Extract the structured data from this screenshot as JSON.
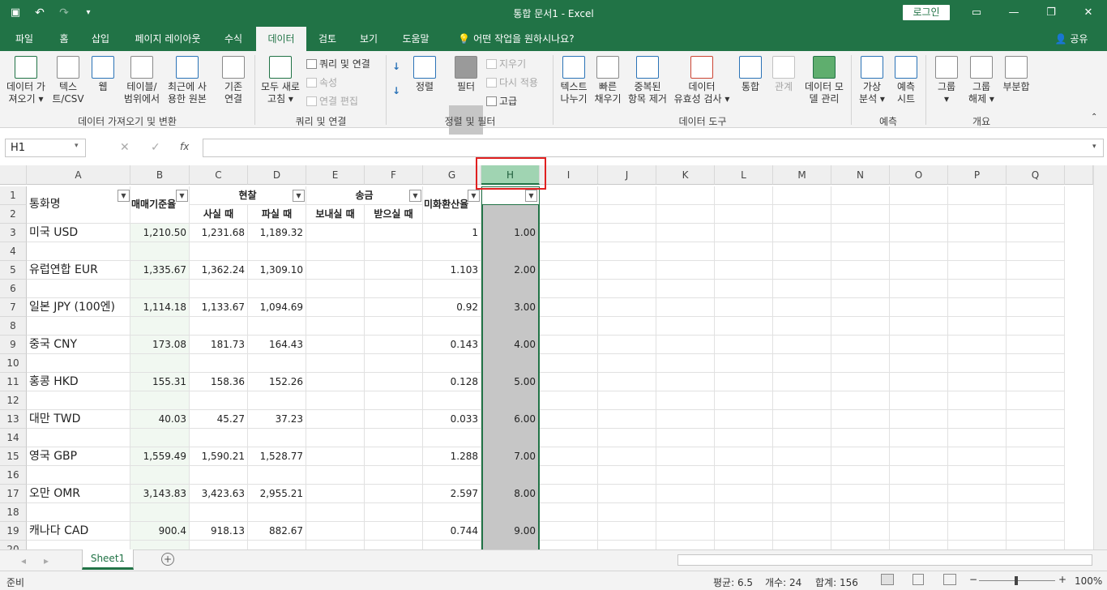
{
  "titlebar": {
    "title": "통합 문서1  -  Excel",
    "login": "로그인",
    "undo_icon": "↶",
    "redo_icon": "↷",
    "save_icon": "save",
    "customize": "▾"
  },
  "tabs": [
    "파일",
    "홈",
    "삽입",
    "페이지 레이아웃",
    "수식",
    "데이터",
    "검토",
    "보기",
    "도움말",
    "💡 어떤 작업을 원하시나요?"
  ],
  "share": "공유",
  "ribbon": {
    "get_data": [
      "데이터 가",
      "져오기 ▾"
    ],
    "text_csv": [
      "텍스",
      "트/CSV"
    ],
    "web": "웹",
    "from_table": [
      "테이블/",
      "범위에서"
    ],
    "recent_source": [
      "최근에 사",
      "용한 원본"
    ],
    "existing_conn": [
      "기존",
      "연결"
    ],
    "group_get": "데이터 가져오기 및 변환",
    "refresh_all": [
      "모두 새로",
      "고침 ▾"
    ],
    "queries_conn": "쿼리 및 연결",
    "properties": "속성",
    "edit_links": "연결 편집",
    "group_queries": "쿼리 및 연결",
    "sort_az": "↓",
    "sort_za": "↓",
    "sort": "정렬",
    "filter": "필터",
    "clear": "지우기",
    "reapply": "다시 적용",
    "advanced": "고급",
    "group_sort": "정렬 및 필터",
    "text_to_col": [
      "텍스트",
      "나누기"
    ],
    "flash_fill": [
      "빠른",
      "채우기"
    ],
    "remove_dup": [
      "중복된",
      "항목 제거"
    ],
    "data_valid": [
      "데이터",
      "유효성 검사 ▾"
    ],
    "consolidate": "통합",
    "relations": "관계",
    "data_model": [
      "데이터 모",
      "델 관리"
    ],
    "group_tools": "데이터 도구",
    "what_if": [
      "가상",
      "분석 ▾"
    ],
    "forecast_sheet": [
      "예측",
      "시트"
    ],
    "group_forecast": "예측",
    "group_btn": [
      "그룹",
      "▾"
    ],
    "ungroup": [
      "그룹",
      "해제 ▾"
    ],
    "subtotal": "부분합",
    "group_outline": "개요"
  },
  "formula_bar": {
    "name_box": "H1",
    "fx": "fx",
    "value": "",
    "cancel": "✕",
    "enter": "✓"
  },
  "columns": [
    "A",
    "B",
    "C",
    "D",
    "E",
    "F",
    "G",
    "H",
    "I",
    "J",
    "K",
    "L",
    "M",
    "N",
    "O",
    "P",
    "Q"
  ],
  "header": {
    "a": "통화명",
    "b": "매매기준율",
    "cash": "현찰",
    "buy": "사실 때",
    "sell": "파실 때",
    "transfer": "송금",
    "send": "보내실 때",
    "receive": "받으실 때",
    "usd_rate": "미화환산율"
  },
  "rows": [
    {
      "r": 3,
      "a": "미국 USD",
      "b": "1,210.50",
      "c": "1,231.68",
      "d": "1,189.32",
      "g": "1",
      "h": "1.00"
    },
    {
      "r": 5,
      "a": "유럽연합 EUR",
      "b": "1,335.67",
      "c": "1,362.24",
      "d": "1,309.10",
      "g": "1.103",
      "h": "2.00"
    },
    {
      "r": 7,
      "a": "일본 JPY (100엔)",
      "b": "1,114.18",
      "c": "1,133.67",
      "d": "1,094.69",
      "g": "0.92",
      "h": "3.00"
    },
    {
      "r": 9,
      "a": "중국 CNY",
      "b": "173.08",
      "c": "181.73",
      "d": "164.43",
      "g": "0.143",
      "h": "4.00"
    },
    {
      "r": 11,
      "a": "홍콩 HKD",
      "b": "155.31",
      "c": "158.36",
      "d": "152.26",
      "g": "0.128",
      "h": "5.00"
    },
    {
      "r": 13,
      "a": "대만 TWD",
      "b": "40.03",
      "c": "45.27",
      "d": "37.23",
      "g": "0.033",
      "h": "6.00"
    },
    {
      "r": 15,
      "a": "영국 GBP",
      "b": "1,559.49",
      "c": "1,590.21",
      "d": "1,528.77",
      "g": "1.288",
      "h": "7.00"
    },
    {
      "r": 17,
      "a": "오만 OMR",
      "b": "3,143.83",
      "c": "3,423.63",
      "d": "2,955.21",
      "g": "2.597",
      "h": "8.00"
    },
    {
      "r": 19,
      "a": "캐나다 CAD",
      "b": "900.4",
      "c": "918.13",
      "d": "882.67",
      "g": "0.744",
      "h": "9.00"
    }
  ],
  "sheet": {
    "tab": "Sheet1",
    "add": "+"
  },
  "status": {
    "ready": "준비",
    "average": "평균: 6.5",
    "count": "개수: 24",
    "sum": "합계: 156",
    "zoom": "100%"
  }
}
